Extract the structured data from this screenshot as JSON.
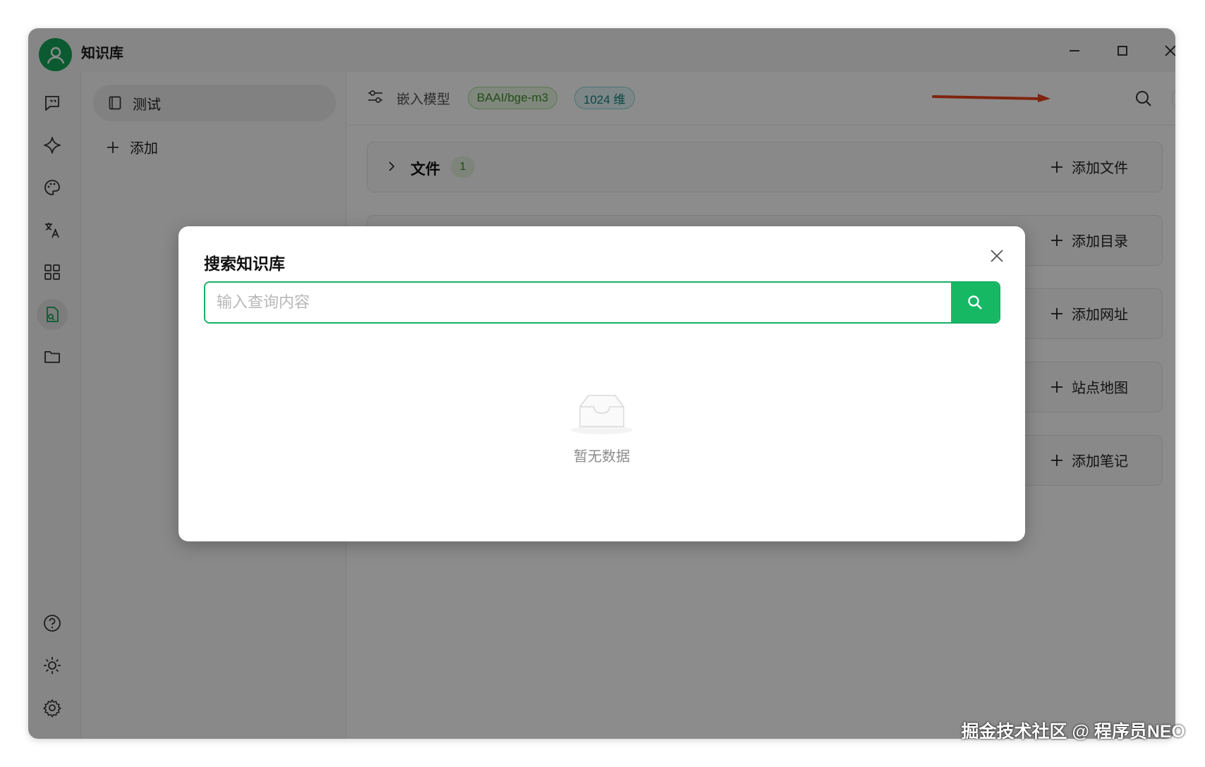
{
  "window": {
    "title": "知识库",
    "minimize_icon": "minimize-icon",
    "maximize_icon": "maximize-icon",
    "close_icon": "close-icon"
  },
  "rail": {
    "items": [
      {
        "icon": "chat-icon"
      },
      {
        "icon": "sparkle-icon"
      },
      {
        "icon": "palette-icon"
      },
      {
        "icon": "translate-icon"
      },
      {
        "icon": "apps-grid-icon"
      },
      {
        "icon": "knowledge-base-icon",
        "active": true
      },
      {
        "icon": "folder-icon"
      }
    ],
    "bottom": [
      {
        "icon": "help-icon"
      },
      {
        "icon": "sun-icon"
      },
      {
        "icon": "settings-gear-icon"
      }
    ]
  },
  "kb_list": {
    "items": [
      {
        "label": "测试",
        "icon": "book-icon"
      }
    ],
    "add_label": "添加"
  },
  "toolbar": {
    "embed_label": "嵌入模型",
    "model_tag": "BAAI/bge-m3",
    "dim_tag": "1024 维"
  },
  "sections": [
    {
      "title": "文件",
      "count": "1",
      "action": "添加文件"
    },
    {
      "title": "",
      "count": "",
      "action": "添加目录"
    },
    {
      "title": "",
      "count": "",
      "action": "添加网址"
    },
    {
      "title": "",
      "count": "",
      "action": "站点地图"
    },
    {
      "title": "",
      "count": "",
      "action": "添加笔记"
    }
  ],
  "modal": {
    "title": "搜索知识库",
    "search_placeholder": "输入查询内容",
    "search_value": "",
    "empty_text": "暂无数据"
  },
  "watermark": "掘金技术社区 @ 程序员NEO",
  "colors": {
    "brand_green": "#16b864",
    "annotation_arrow": "#e8431c"
  }
}
